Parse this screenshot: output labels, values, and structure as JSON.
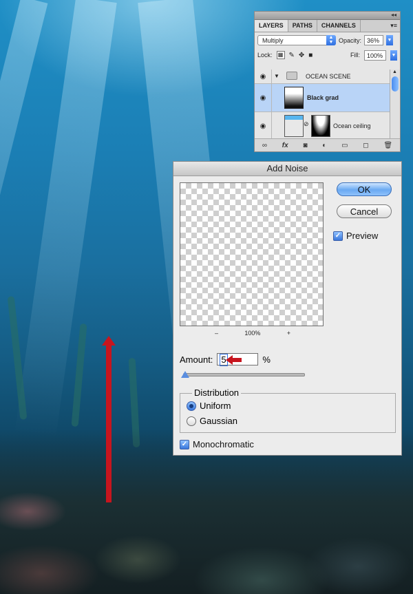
{
  "layers_panel": {
    "tabs": [
      "LAYERS",
      "PATHS",
      "CHANNELS"
    ],
    "blend_mode": "Multiply",
    "opacity_label": "Opacity:",
    "opacity_value": "36%",
    "lock_label": "Lock:",
    "fill_label": "Fill:",
    "fill_value": "100%",
    "layers": [
      {
        "name": "OCEAN SCENE",
        "type": "group"
      },
      {
        "name": "Black grad",
        "type": "layer",
        "selected": true
      },
      {
        "name": "Ocean ceiling",
        "type": "layer-with-mask"
      }
    ],
    "icons": [
      "link-icon",
      "fx-icon",
      "mask-icon",
      "adjustment-icon",
      "folder-icon",
      "new-layer-icon",
      "trash-icon"
    ]
  },
  "dialog": {
    "title": "Add Noise",
    "ok_label": "OK",
    "cancel_label": "Cancel",
    "preview_label": "Preview",
    "preview_checked": true,
    "zoom_minus": "–",
    "zoom_value": "100%",
    "zoom_plus": "+",
    "amount_label": "Amount:",
    "amount_value": "5",
    "amount_unit": "%",
    "amount_slider_fraction": 0.01,
    "distribution_label": "Distribution",
    "distribution_options": [
      "Uniform",
      "Gaussian"
    ],
    "distribution_selected": "Uniform",
    "monochromatic_label": "Monochromatic",
    "monochromatic_checked": true
  },
  "colors": {
    "annotation_red": "#c7151e",
    "selection_blue": "#b9d4f7",
    "aqua_blue": "#3977dc"
  }
}
